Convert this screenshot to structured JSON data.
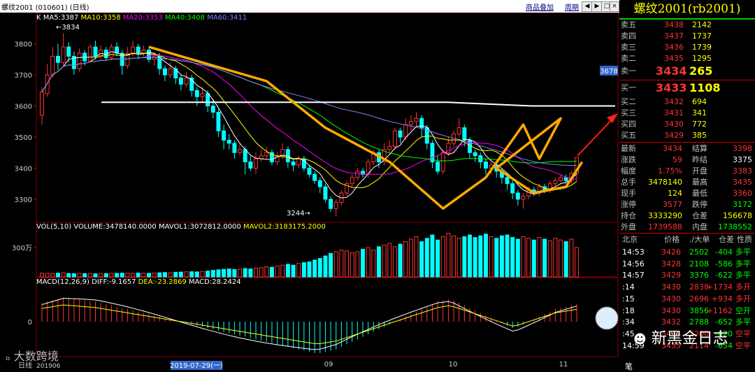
{
  "title": "螺纹2001 (010601) (日线)",
  "links": [
    "商品叠加",
    "周期"
  ],
  "window_buttons": [
    "◀",
    "▶",
    "□",
    "×"
  ],
  "ma_legend": [
    {
      "text": "K",
      "color": "#ffffff"
    },
    {
      "text": "MA5:3387",
      "color": "#ffffff"
    },
    {
      "text": "MA10:3358",
      "color": "#ffff00"
    },
    {
      "text": "MA20:3353",
      "color": "#ff00ff"
    },
    {
      "text": "MA40:3408",
      "color": "#00ff00"
    },
    {
      "text": "MA60:3411",
      "color": "#8080ff"
    }
  ],
  "vol_legend": [
    {
      "text": "VOL(5,10)",
      "color": "#ffffff"
    },
    {
      "text": "VOLUME:3478140.0000",
      "color": "#ffffff"
    },
    {
      "text": "MAVOL1:3072812.0000",
      "color": "#ffffff"
    },
    {
      "text": "MAVOL2:3183175.2000",
      "color": "#ffff00"
    }
  ],
  "macd_legend": [
    {
      "text": "MACD(12,26,9)",
      "color": "#ffffff"
    },
    {
      "text": "DIFF:-9.1657",
      "color": "#ffffff"
    },
    {
      "text": "DEA:-23.2869",
      "color": "#ffff00"
    },
    {
      "text": "MACD:28.2424",
      "color": "#ffffff"
    }
  ],
  "price_ticks": [
    "3800",
    "3700",
    "3600",
    "3500",
    "3400",
    "3300"
  ],
  "vol_tick": "300万",
  "macd_tick": "0",
  "annot_high": "3834",
  "annot_low": "3244",
  "price_tag": "3678",
  "xaxis": {
    "left": "日线",
    "year": "201906",
    "cursor_date": "2019-07-29(一)",
    "months": [
      "09",
      "10",
      "11"
    ]
  },
  "right_panel": {
    "title": "螺纹2001(rb2001)",
    "asks": [
      {
        "label": "卖五",
        "price": "3438",
        "vol": "2142"
      },
      {
        "label": "卖四",
        "price": "3437",
        "vol": "1737"
      },
      {
        "label": "卖三",
        "price": "3436",
        "vol": "1739"
      },
      {
        "label": "卖二",
        "price": "3435",
        "vol": "1295"
      },
      {
        "label": "卖一",
        "price": "3434",
        "vol": "265"
      }
    ],
    "bids": [
      {
        "label": "买一",
        "price": "3433",
        "vol": "1108"
      },
      {
        "label": "买二",
        "price": "3432",
        "vol": "694"
      },
      {
        "label": "买三",
        "price": "3431",
        "vol": "341"
      },
      {
        "label": "买四",
        "price": "3430",
        "vol": "772"
      },
      {
        "label": "买五",
        "price": "3429",
        "vol": "385"
      }
    ],
    "stats": [
      {
        "l1": "最新",
        "v1": "3434",
        "c1": "red",
        "l2": "结算",
        "v2": "3398",
        "c2": "red"
      },
      {
        "l1": "涨跌",
        "v1": "59",
        "c1": "red",
        "l2": "昨结",
        "v2": "3375",
        "c2": "wh"
      },
      {
        "l1": "幅度",
        "v1": "1.75%",
        "c1": "red",
        "l2": "开盘",
        "v2": "3383",
        "c2": "red"
      },
      {
        "l1": "总手",
        "v1": "3478140",
        "c1": "yel",
        "l2": "最高",
        "v2": "3435",
        "c2": "red"
      },
      {
        "l1": "现手",
        "v1": "124",
        "c1": "yel",
        "l2": "最低",
        "v2": "3360",
        "c2": "red"
      },
      {
        "l1": "涨停",
        "v1": "3577",
        "c1": "red",
        "l2": "跌停",
        "v2": "3172",
        "c2": "grn"
      },
      {
        "l1": "持仓",
        "v1": "3333290",
        "c1": "yel",
        "l2": "仓差",
        "v2": "156678",
        "c2": "yel"
      },
      {
        "l1": "外盘",
        "v1": "1739588",
        "c1": "red",
        "l2": "内盘",
        "v2": "1738552",
        "c2": "grn"
      }
    ],
    "ticks_header": {
      "exchange": "北京",
      "cols": [
        "价格",
        "./大单",
        "仓差",
        "性质"
      ]
    },
    "ticks": [
      {
        "time": "14:53",
        "price": "3426",
        "vol": "2502",
        "diff": "-404",
        "nature": "多平",
        "vc": "grn",
        "dc": "grn",
        "nc": "grn"
      },
      {
        "time": "14:56",
        "price": "3428",
        "vol": "2108",
        "diff": "-586",
        "nature": "多平",
        "vc": "grn",
        "dc": "grn",
        "nc": "grn"
      },
      {
        "time": "14:57",
        "price": "3429",
        "vol": "3376",
        "diff": "-622",
        "nature": "多平",
        "vc": "grn",
        "dc": "grn",
        "nc": "grn"
      },
      {
        "time": ":14",
        "price": "3430",
        "vol": "2838",
        "diff": "+1734",
        "nature": "多开",
        "vc": "red",
        "dc": "red",
        "nc": "red"
      },
      {
        "time": ":15",
        "price": "3430",
        "vol": "2696",
        "diff": "+934",
        "nature": "多开",
        "vc": "red",
        "dc": "red",
        "nc": "red"
      },
      {
        "time": ":18",
        "price": "3430",
        "vol": "3856",
        "diff": "+1162",
        "nature": "空开",
        "vc": "grn",
        "dc": "red",
        "nc": "grn"
      },
      {
        "time": ":34",
        "price": "3432",
        "vol": "2788",
        "diff": "-652",
        "nature": "多平",
        "vc": "grn",
        "dc": "grn",
        "nc": "grn"
      },
      {
        "time": ":45",
        "price": "3434",
        "vol": "2200",
        "diff": "-620",
        "nature": "空平",
        "vc": "red",
        "dc": "grn",
        "nc": "red"
      },
      {
        "time": "14:59",
        "price": "3435",
        "vol": "2114",
        "diff": "-654",
        "nature": "空平",
        "vc": "red",
        "dc": "grn",
        "nc": "red"
      }
    ],
    "bottom_tab": "笔"
  },
  "watermark_left": "大数跨境",
  "watermark_right": "新黑金日志",
  "colors": {
    "up": "#ff3333",
    "down": "#00ffff",
    "grid": "#800000",
    "pattern": "#ffaa00",
    "arrow": "#ff2020"
  },
  "chart_data": {
    "type": "candlestick",
    "price_ylim": [
      3230,
      3860
    ],
    "neckline": [
      3612,
      3600
    ],
    "candles": [
      [
        3570,
        3645,
        3540,
        3660
      ],
      [
        3640,
        3700,
        3630,
        3735
      ],
      [
        3700,
        3760,
        3690,
        3790
      ],
      [
        3760,
        3740,
        3715,
        3800
      ],
      [
        3740,
        3790,
        3730,
        3834
      ],
      [
        3790,
        3760,
        3740,
        3805
      ],
      [
        3760,
        3720,
        3700,
        3775
      ],
      [
        3720,
        3770,
        3710,
        3785
      ],
      [
        3770,
        3745,
        3730,
        3780
      ],
      [
        3745,
        3790,
        3740,
        3800
      ],
      [
        3790,
        3760,
        3750,
        3810
      ],
      [
        3760,
        3780,
        3750,
        3795
      ],
      [
        3780,
        3755,
        3745,
        3790
      ],
      [
        3755,
        3790,
        3750,
        3800
      ],
      [
        3790,
        3770,
        3760,
        3805
      ],
      [
        3770,
        3730,
        3700,
        3780
      ],
      [
        3730,
        3770,
        3720,
        3790
      ],
      [
        3770,
        3790,
        3760,
        3810
      ],
      [
        3790,
        3770,
        3750,
        3800
      ],
      [
        3770,
        3780,
        3760,
        3795
      ],
      [
        3780,
        3750,
        3740,
        3790
      ],
      [
        3750,
        3760,
        3730,
        3770
      ],
      [
        3760,
        3720,
        3700,
        3770
      ],
      [
        3720,
        3700,
        3680,
        3730
      ],
      [
        3700,
        3720,
        3690,
        3740
      ],
      [
        3720,
        3690,
        3670,
        3730
      ],
      [
        3690,
        3670,
        3650,
        3700
      ],
      [
        3670,
        3690,
        3660,
        3710
      ],
      [
        3690,
        3650,
        3630,
        3700
      ],
      [
        3650,
        3630,
        3600,
        3660
      ],
      [
        3630,
        3640,
        3610,
        3660
      ],
      [
        3640,
        3600,
        3580,
        3650
      ],
      [
        3600,
        3580,
        3560,
        3620
      ],
      [
        3580,
        3520,
        3500,
        3590
      ],
      [
        3520,
        3490,
        3460,
        3540
      ],
      [
        3490,
        3480,
        3460,
        3510
      ],
      [
        3480,
        3450,
        3430,
        3490
      ],
      [
        3450,
        3460,
        3440,
        3480
      ],
      [
        3460,
        3420,
        3380,
        3470
      ],
      [
        3420,
        3400,
        3390,
        3440
      ],
      [
        3400,
        3430,
        3380,
        3450
      ],
      [
        3430,
        3440,
        3420,
        3460
      ],
      [
        3440,
        3450,
        3430,
        3470
      ],
      [
        3450,
        3420,
        3410,
        3460
      ],
      [
        3420,
        3440,
        3410,
        3450
      ],
      [
        3440,
        3460,
        3430,
        3480
      ],
      [
        3460,
        3420,
        3400,
        3470
      ],
      [
        3420,
        3410,
        3390,
        3430
      ],
      [
        3410,
        3430,
        3400,
        3440
      ],
      [
        3430,
        3400,
        3390,
        3440
      ],
      [
        3400,
        3380,
        3370,
        3410
      ],
      [
        3380,
        3360,
        3350,
        3390
      ],
      [
        3360,
        3340,
        3320,
        3370
      ],
      [
        3340,
        3300,
        3290,
        3350
      ],
      [
        3300,
        3270,
        3260,
        3310
      ],
      [
        3270,
        3290,
        3244,
        3300
      ],
      [
        3290,
        3320,
        3280,
        3330
      ],
      [
        3320,
        3350,
        3310,
        3360
      ],
      [
        3350,
        3370,
        3340,
        3380
      ],
      [
        3370,
        3390,
        3360,
        3400
      ],
      [
        3390,
        3380,
        3370,
        3400
      ],
      [
        3380,
        3420,
        3370,
        3430
      ],
      [
        3420,
        3450,
        3410,
        3460
      ],
      [
        3450,
        3420,
        3400,
        3460
      ],
      [
        3420,
        3460,
        3410,
        3480
      ],
      [
        3460,
        3470,
        3450,
        3490
      ],
      [
        3470,
        3520,
        3460,
        3530
      ],
      [
        3520,
        3500,
        3480,
        3530
      ],
      [
        3500,
        3540,
        3490,
        3560
      ],
      [
        3540,
        3550,
        3520,
        3570
      ],
      [
        3550,
        3560,
        3530,
        3580
      ],
      [
        3560,
        3530,
        3500,
        3570
      ],
      [
        3530,
        3480,
        3460,
        3540
      ],
      [
        3480,
        3420,
        3400,
        3490
      ],
      [
        3420,
        3390,
        3380,
        3440
      ],
      [
        3390,
        3450,
        3380,
        3460
      ],
      [
        3450,
        3480,
        3440,
        3500
      ],
      [
        3480,
        3510,
        3470,
        3520
      ],
      [
        3510,
        3530,
        3500,
        3560
      ],
      [
        3530,
        3490,
        3470,
        3540
      ],
      [
        3490,
        3450,
        3430,
        3500
      ],
      [
        3450,
        3440,
        3420,
        3460
      ],
      [
        3440,
        3420,
        3400,
        3450
      ],
      [
        3420,
        3400,
        3380,
        3430
      ],
      [
        3400,
        3410,
        3380,
        3420
      ],
      [
        3410,
        3390,
        3370,
        3420
      ],
      [
        3390,
        3370,
        3350,
        3400
      ],
      [
        3370,
        3350,
        3330,
        3380
      ],
      [
        3350,
        3320,
        3300,
        3360
      ],
      [
        3320,
        3300,
        3280,
        3330
      ],
      [
        3300,
        3310,
        3270,
        3320
      ],
      [
        3310,
        3330,
        3300,
        3340
      ],
      [
        3330,
        3320,
        3310,
        3340
      ],
      [
        3320,
        3340,
        3310,
        3350
      ],
      [
        3340,
        3330,
        3320,
        3350
      ],
      [
        3330,
        3350,
        3320,
        3360
      ],
      [
        3350,
        3360,
        3340,
        3370
      ],
      [
        3360,
        3370,
        3350,
        3380
      ],
      [
        3370,
        3360,
        3350,
        3380
      ],
      [
        3360,
        3383,
        3350,
        3390
      ],
      [
        3383,
        3434,
        3360,
        3435
      ]
    ],
    "volume_series": [
      0.45,
      0.42,
      0.4,
      0.44,
      0.48,
      0.41,
      0.39,
      0.43,
      0.4,
      0.42,
      0.38,
      0.41,
      0.4,
      0.43,
      0.42,
      0.45,
      0.44,
      0.42,
      0.46,
      0.44,
      0.43,
      0.47,
      0.49,
      0.52,
      0.5,
      0.55,
      0.58,
      0.6,
      0.62,
      0.6,
      0.65,
      0.7,
      0.78,
      0.85,
      0.9,
      0.95,
      0.88,
      0.92,
      1.0,
      0.95,
      1.05,
      1.1,
      1.2,
      1.15,
      1.3,
      1.4,
      1.5,
      1.4,
      1.6,
      1.7,
      1.8,
      2.0,
      2.2,
      2.5,
      2.8,
      3.0,
      3.2,
      3.1,
      2.9,
      3.0,
      3.3,
      3.5,
      3.2,
      3.6,
      3.8,
      4.0,
      3.6,
      3.9,
      4.2,
      4.5,
      4.8,
      4.2,
      4.6,
      5.0,
      4.4,
      4.8,
      5.2,
      4.9,
      4.6,
      4.8,
      5.0,
      4.7,
      4.9,
      5.1,
      4.8,
      4.6,
      4.9,
      5.0,
      4.7,
      4.5,
      4.8,
      4.6,
      4.4,
      4.7,
      4.5,
      4.3,
      4.6,
      4.4,
      4.2,
      4.5,
      3.5
    ],
    "macd_series": [
      30,
      32,
      34,
      36,
      38,
      37,
      36,
      35,
      34,
      33,
      32,
      30,
      28,
      26,
      24,
      22,
      20,
      18,
      16,
      14,
      12,
      10,
      8,
      6,
      4,
      2,
      0,
      -2,
      -4,
      -6,
      -8,
      -10,
      -12,
      -14,
      -16,
      -18,
      -20,
      -22,
      -24,
      -26,
      -28,
      -30,
      -32,
      -34,
      -36,
      -38,
      -40,
      -42,
      -44,
      -46,
      -48,
      -50,
      -50,
      -48,
      -46,
      -44,
      -40,
      -36,
      -32,
      -28,
      -24,
      -20,
      -16,
      -12,
      -8,
      -4,
      0,
      4,
      8,
      12,
      16,
      20,
      24,
      28,
      32,
      34,
      36,
      34,
      30,
      26,
      22,
      18,
      14,
      10,
      6,
      2,
      -2,
      -6,
      -10,
      -8,
      -4,
      0,
      4,
      8,
      12,
      16,
      20,
      22,
      24,
      26,
      28
    ]
  }
}
